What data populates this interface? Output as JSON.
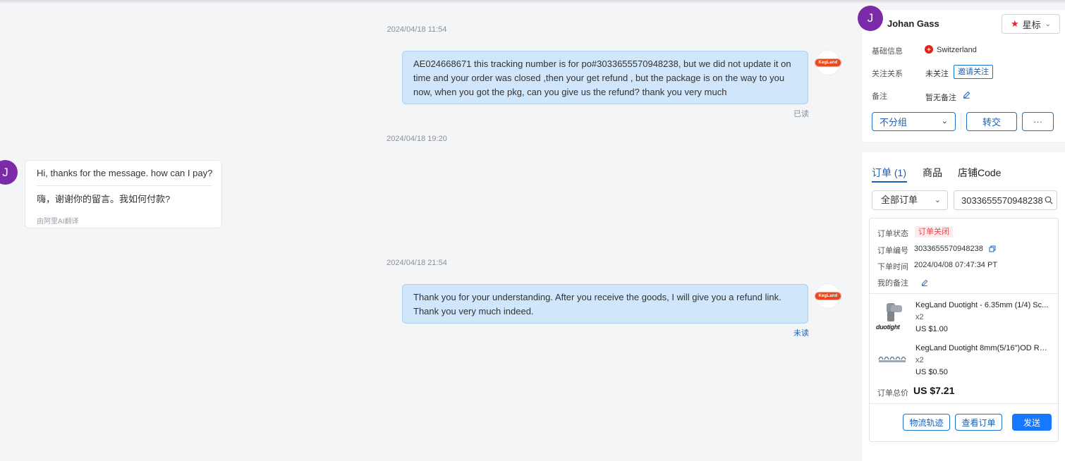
{
  "chat": {
    "messages": [
      {
        "timestamp": "2024/04/18 11:54",
        "direction": "outgoing",
        "text": "AE024668671  this tracking number is for  po#3033655570948238, but we did not update it on time  and your order was closed  ,then your get refund , but the package is on the way to you now,  when you got the pkg,  can you give us the refund?  thank you very much",
        "status": "已读"
      },
      {
        "timestamp": "2024/04/18 19:20",
        "direction": "incoming",
        "text": "Hi, thanks for the message. how can I pay?",
        "translation": "嗨，谢谢你的留言。我如何付款?",
        "translation_note": "由阿里AI翻译"
      },
      {
        "timestamp": "2024/04/18 21:54",
        "direction": "outgoing",
        "text": "Thank you for your understanding. After you receive the goods, I will give you a refund link. Thank you very much indeed.",
        "status": "未读"
      }
    ],
    "seller_logo_text": "KegLand",
    "buyer_initial": "J",
    "read_color": "#8a8f99",
    "unread_color": "#1a5fb4"
  },
  "customer": {
    "initial": "J",
    "name": "Johan Gass",
    "star_label": "星标",
    "basic_info_label": "基础信息",
    "country": "Switzerland",
    "follow_label": "关注关系",
    "follow_value": "未关注",
    "invite_follow": "邀请关注",
    "note_label": "备注",
    "note_value": "暂无备注",
    "group_select": "不分组",
    "transfer_button": "转交",
    "more_button": "···"
  },
  "orders": {
    "tabs": [
      {
        "label": "订单 (1)",
        "active": true
      },
      {
        "label": "商品",
        "active": false
      },
      {
        "label": "店铺Code",
        "active": false
      }
    ],
    "filter": "全部订单",
    "search_value": "3033655570948238",
    "status_label": "订单状态",
    "status_value": "订单关闭",
    "number_label": "订单编号",
    "number_value": "3033655570948238",
    "time_label": "下单时间",
    "time_value": "2024/04/08 07:47:34 PT",
    "remark_label": "我的备注",
    "products": [
      {
        "title": "KegLand Duotight - 6.35mm (1/4) Sc...",
        "qty": "x2",
        "price": "US $1.00",
        "thumb": "duotight"
      },
      {
        "title": "KegLand Duotight 8mm(5/16\")OD Re...",
        "qty": "x2",
        "price": "US $0.50",
        "thumb": "fittings"
      }
    ],
    "total_label": "订单总价",
    "total_value": "US $7.21",
    "buttons": {
      "logistics": "物流轨迹",
      "view_order": "查看订单",
      "send": "发送"
    },
    "accent": "#1677ff",
    "status_color": "#e5484d"
  }
}
